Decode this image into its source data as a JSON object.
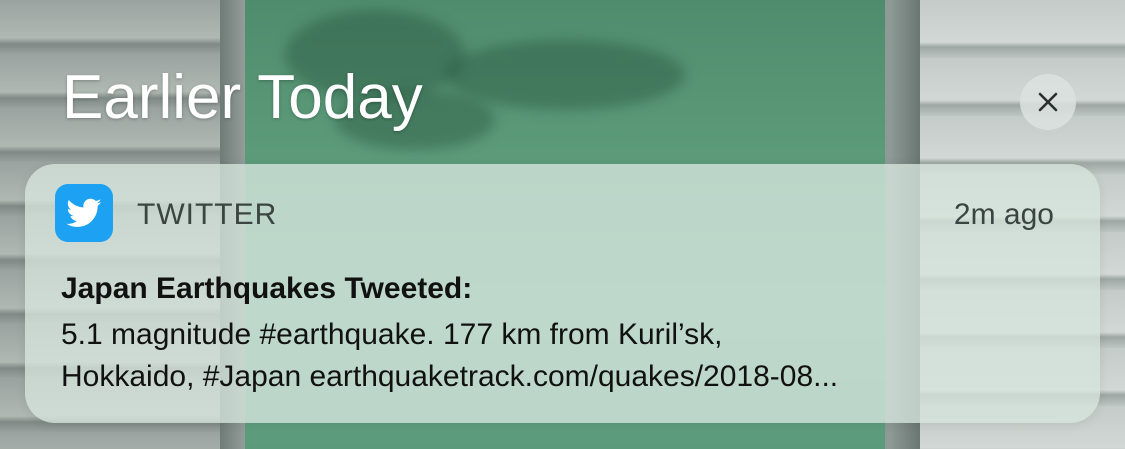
{
  "section": {
    "title": "Earlier Today"
  },
  "notification": {
    "app_name": "TWITTER",
    "time": "2m ago",
    "title": "Japan Earthquakes Tweeted:",
    "body_line_1": "5.1 magnitude #earthquake. 177 km from Kuril’sk,",
    "body_line_2": "Hokkaido, #Japan earthquaketrack.com/quakes/2018-08...",
    "app_icon": "twitter-bird-icon",
    "app_color": "#1da1f2"
  },
  "controls": {
    "clear_icon": "close-icon"
  }
}
